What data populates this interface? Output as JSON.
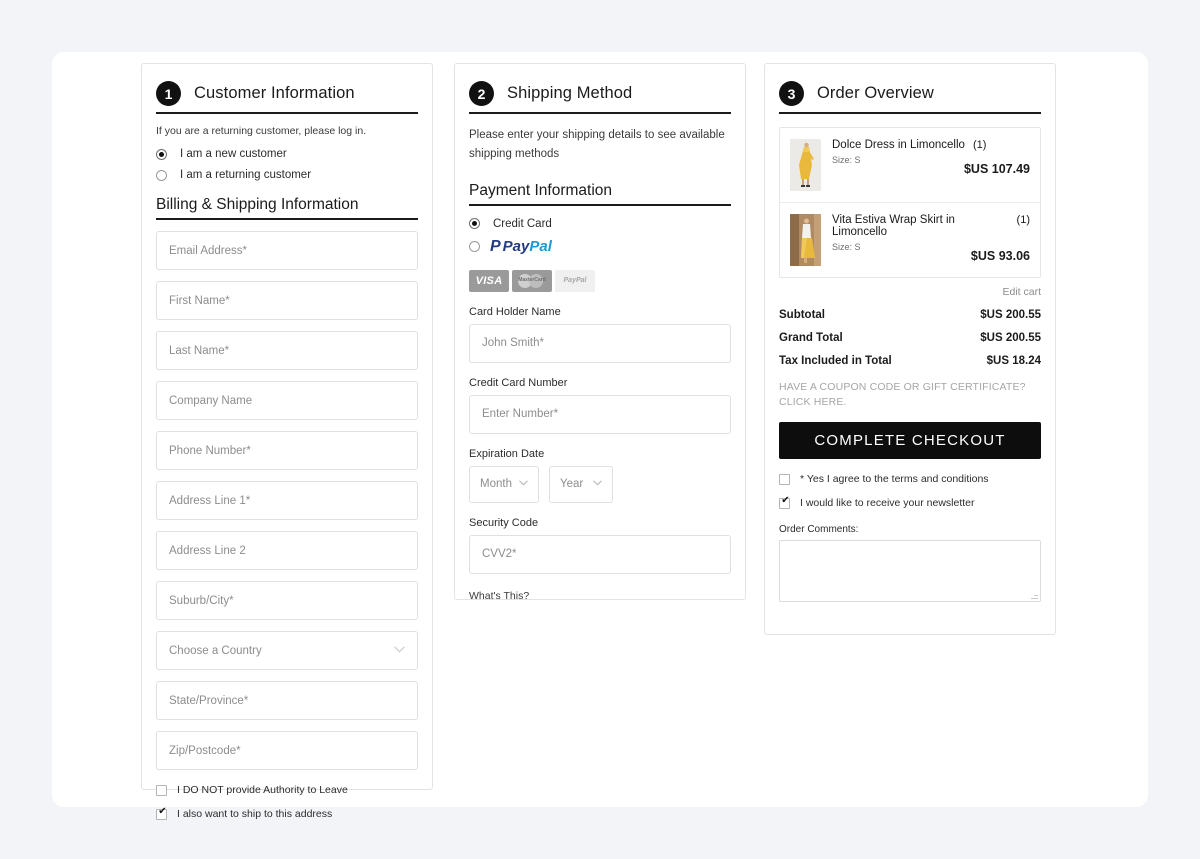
{
  "customer": {
    "number": "1",
    "title": "Customer Information",
    "hint": "If you are a returning customer, please log in.",
    "radios": [
      {
        "label": "I am a new customer",
        "selected": true
      },
      {
        "label": "I am a returning customer",
        "selected": false
      }
    ],
    "billing_title": "Billing & Shipping Information",
    "fields": [
      {
        "placeholder": "Email Address*"
      },
      {
        "placeholder": "First Name*"
      },
      {
        "placeholder": "Last Name*"
      },
      {
        "placeholder": "Company Name"
      },
      {
        "placeholder": "Phone Number*"
      },
      {
        "placeholder": "Address Line 1*"
      },
      {
        "placeholder": "Address Line 2"
      },
      {
        "placeholder": "Suburb/City*"
      }
    ],
    "country_select": {
      "placeholder": "Choose a Country",
      "chevron": "chevron-down-icon"
    },
    "fields_after": [
      {
        "placeholder": "State/Province*"
      },
      {
        "placeholder": "Zip/Postcode*"
      }
    ],
    "checkboxes": [
      {
        "label": "I DO NOT provide Authority to Leave",
        "checked": false
      },
      {
        "label": "I also want to ship to this address",
        "checked": true
      }
    ]
  },
  "shipping": {
    "number": "2",
    "title": "Shipping Method",
    "note": "Please enter your shipping details to see available shipping methods",
    "payment_title": "Payment Information",
    "methods": [
      {
        "label": "Credit Card",
        "selected": true
      },
      {
        "label": "PayPal",
        "selected": false,
        "is_logo": true
      }
    ],
    "paypal_brand": {
      "mark": "P",
      "pay": "Pay",
      "pal": "Pal"
    },
    "logos": [
      {
        "name": "visa-logo",
        "text": "VISA"
      },
      {
        "name": "mastercard-logo",
        "text": "MasterCard"
      },
      {
        "name": "paypal-logo",
        "text": "PayPal"
      }
    ],
    "card_holder": {
      "label": "Card Holder Name",
      "placeholder": "John Smith*"
    },
    "card_number": {
      "label": "Credit Card Number",
      "placeholder": "Enter Number*"
    },
    "expiration": {
      "label": "Expiration Date",
      "month": "Month",
      "year": "Year"
    },
    "security": {
      "label": "Security Code",
      "placeholder": "CVV2*"
    },
    "whats_this": "What's This?"
  },
  "order": {
    "number": "3",
    "title": "Order Overview",
    "items": [
      {
        "name": "Dolce Dress in Limoncello",
        "qty": "(1)",
        "size": "Size: S",
        "price": "$US 107.49",
        "thumb": "dress-thumbnail"
      },
      {
        "name": "Vita Estiva Wrap Skirt in Limoncello",
        "qty": "(1)",
        "size": "Size: S",
        "price": "$US 93.06",
        "thumb": "skirt-thumbnail"
      }
    ],
    "edit_cart": "Edit cart",
    "totals": [
      {
        "label": "Subtotal",
        "value": "$US 200.55"
      },
      {
        "label": "Grand Total",
        "value": "$US 200.55"
      },
      {
        "label": "Tax Included in Total",
        "value": "$US 18.24"
      }
    ],
    "coupon": "HAVE A COUPON CODE OR GIFT CERTIFICATE? CLICK HERE.",
    "checkout_button": "COMPLETE CHECKOUT",
    "checkboxes": [
      {
        "label": "* Yes I agree to the terms and conditions",
        "checked": false
      },
      {
        "label": "I would like to receive your newsletter",
        "checked": true
      }
    ],
    "comments_label": "Order Comments:",
    "comments_value": ""
  },
  "colors": {
    "page_bg": "#f2f4f7",
    "accent": "#111111",
    "border": "#e3e3e3",
    "muted": "#8d8d8d"
  }
}
